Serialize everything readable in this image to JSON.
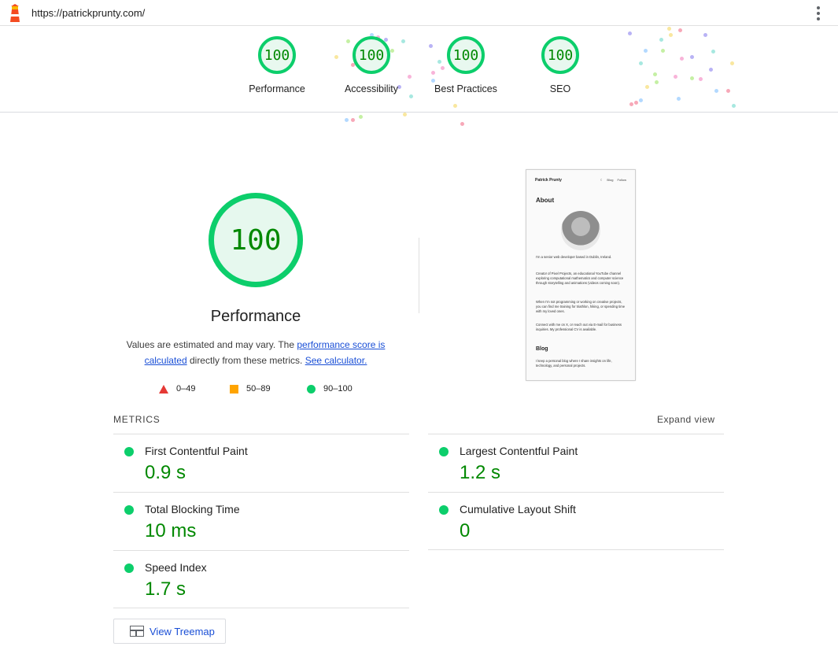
{
  "topbar": {
    "url": "https://patrickprunty.com/",
    "logo_icon": "lighthouse-icon",
    "menu_icon": "kebab-menu-icon"
  },
  "summary": {
    "gauges": [
      {
        "score": "100",
        "label": "Performance"
      },
      {
        "score": "100",
        "label": "Accessibility"
      },
      {
        "score": "100",
        "label": "Best Practices"
      },
      {
        "score": "100",
        "label": "SEO"
      }
    ]
  },
  "performance": {
    "score": "100",
    "title": "Performance",
    "desc_1": "Values are estimated and may vary. The ",
    "link_score": "performance score is calculated",
    "desc_2": " directly from these metrics. ",
    "link_calc": "See calculator.",
    "legend": [
      {
        "range": "0–49",
        "icon": "fail-triangle-icon",
        "color": "#e53935"
      },
      {
        "range": "50–89",
        "icon": "average-square-icon",
        "color": "#ffa400"
      },
      {
        "range": "90–100",
        "icon": "pass-circle-icon",
        "color": "#0cce6b"
      }
    ]
  },
  "thumbnail": {
    "name": "Patrick Prunty",
    "nav": [
      "☾",
      "Blog",
      "Follow"
    ],
    "about": "About",
    "p1": "I'm a senior web developer based in Dublin, Ireland.",
    "p2": "Creator of Pixel Projects, an educational YouTube channel exploring computational mathematics and computer science through storytelling and animations (videos coming soon).",
    "p3": "When I'm not programming or working on creative projects, you can find me training for triathlon, hiking, or spending time with my loved ones.",
    "p4": "Connect with me on X, or reach out via E-mail for business inquiries. My professional CV is available.",
    "blog": "Blog",
    "p5": "I keep a personal blog where I share insights on life, technology, and personal projects."
  },
  "metrics": {
    "header": "METRICS",
    "expand": "Expand view",
    "items": [
      {
        "name": "First Contentful Paint",
        "value": "0.9 s"
      },
      {
        "name": "Largest Contentful Paint",
        "value": "1.2 s"
      },
      {
        "name": "Total Blocking Time",
        "value": "10 ms"
      },
      {
        "name": "Cumulative Layout Shift",
        "value": "0"
      },
      {
        "name": "Speed Index",
        "value": "1.7 s"
      }
    ],
    "pass_color": "#0cce6b",
    "value_color": "#008800"
  },
  "treemap": {
    "label": "View Treemap",
    "icon": "treemap-icon"
  }
}
